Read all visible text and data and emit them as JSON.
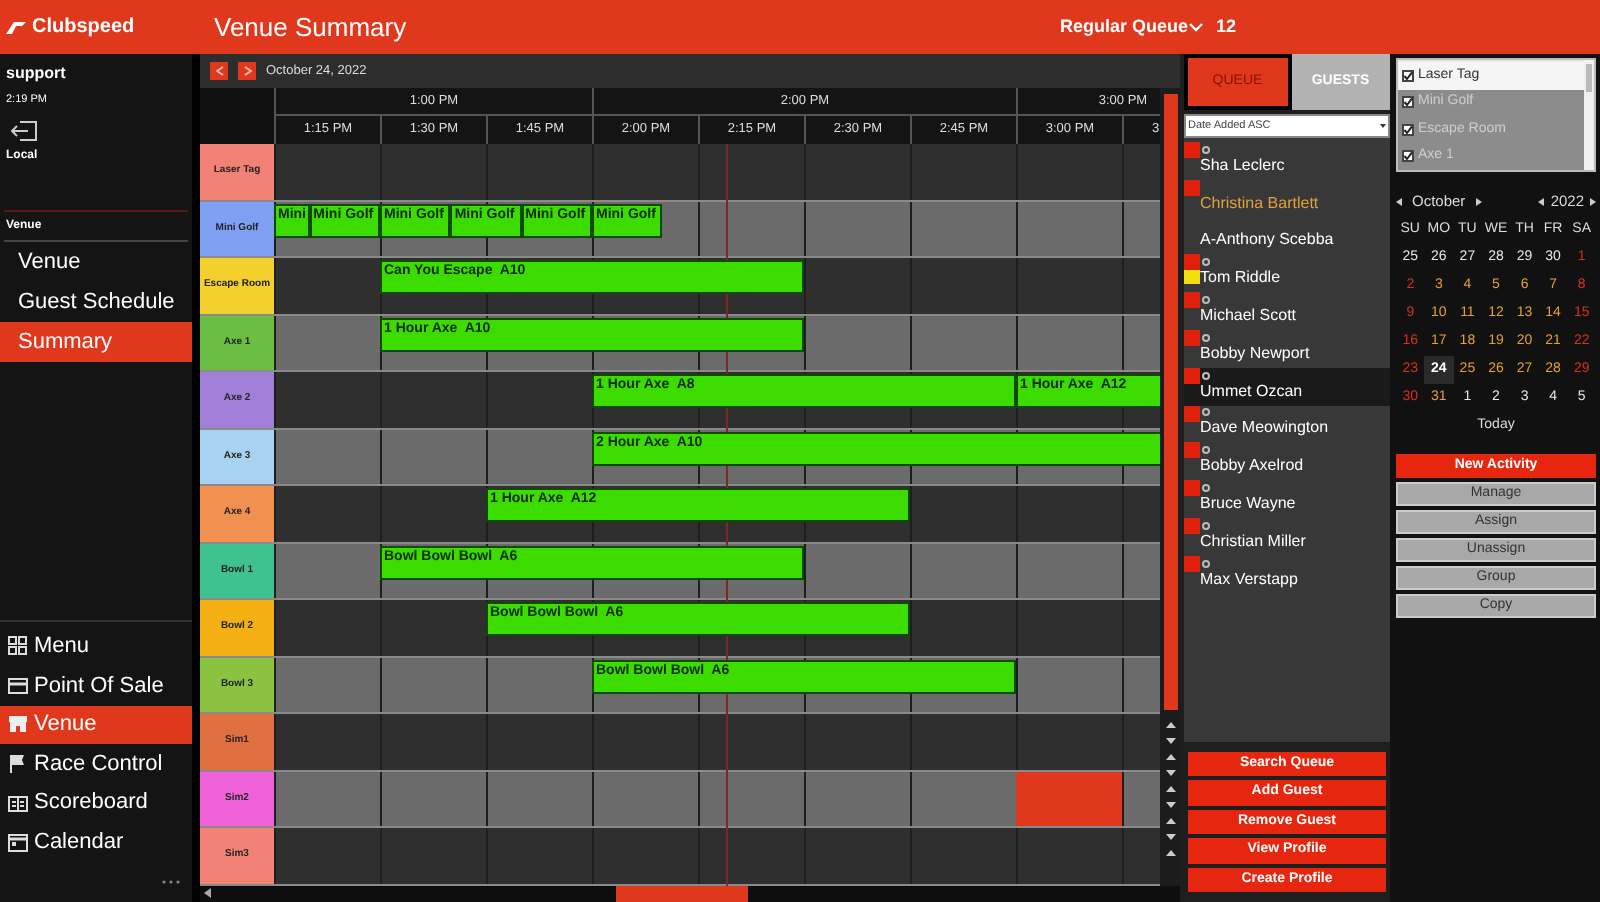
{
  "app": {
    "logo": "Clubspeed",
    "title": "Venue Summary",
    "queue_name": "Regular Queue",
    "queue_count": "12"
  },
  "user": {
    "name": "support",
    "time": "2:19 PM",
    "location": "Local"
  },
  "sidebar": {
    "section": "Venue",
    "items": [
      {
        "label": "Venue",
        "selected": false
      },
      {
        "label": "Guest Schedule",
        "selected": false
      },
      {
        "label": "Summary",
        "selected": true
      }
    ]
  },
  "nav": [
    {
      "label": "Menu",
      "kind": "menu",
      "selected": false
    },
    {
      "label": "Point Of Sale",
      "kind": "pos",
      "selected": false
    },
    {
      "label": "Venue",
      "kind": "venue",
      "selected": true
    },
    {
      "label": "Race Control",
      "kind": "race",
      "selected": false
    },
    {
      "label": "Scoreboard",
      "kind": "scoreboard",
      "selected": false
    },
    {
      "label": "Calendar",
      "kind": "calendar",
      "selected": false
    }
  ],
  "schedule": {
    "date": "October 24, 2022",
    "hours": [
      {
        "label": "1:00 PM"
      },
      {
        "label": "2:00 PM"
      },
      {
        "label": "3:00 PM"
      }
    ],
    "columns": [
      "1:15 PM",
      "1:30 PM",
      "1:45 PM",
      "2:00 PM",
      "2:15 PM",
      "2:30 PM",
      "2:45 PM",
      "3:00 PM",
      "3"
    ],
    "resources": [
      {
        "name": "Laser Tag",
        "color": "#f28276"
      },
      {
        "name": "Mini Golf",
        "color": "#7f9ff2",
        "events": [
          {
            "kind": "booking",
            "label": "Mini"
          },
          {
            "kind": "booking",
            "label": "Mini Golf"
          },
          {
            "kind": "booking",
            "label": "Mini Golf"
          },
          {
            "kind": "booking",
            "label": "Mini Golf"
          },
          {
            "kind": "booking",
            "label": "Mini Golf"
          },
          {
            "kind": "booking",
            "label": "Mini Golf"
          }
        ]
      },
      {
        "name": "Escape Room",
        "color": "#f3d02e",
        "events": [
          {
            "kind": "booking",
            "label": "Can You Escape  A10"
          }
        ]
      },
      {
        "name": "Axe 1",
        "color": "#6cbd43",
        "events": [
          {
            "kind": "booking",
            "label": "1 Hour Axe  A10"
          }
        ]
      },
      {
        "name": "Axe 2",
        "color": "#a17fd9",
        "events": [
          {
            "kind": "booking",
            "label": "1 Hour Axe  A8"
          },
          {
            "kind": "booking",
            "label": "1 Hour Axe  A12"
          }
        ]
      },
      {
        "name": "Axe 3",
        "color": "#a8d3f0",
        "events": [
          {
            "kind": "booking",
            "label": "2 Hour Axe  A10"
          }
        ]
      },
      {
        "name": "Axe 4",
        "color": "#f2914f",
        "events": [
          {
            "kind": "booking",
            "label": "1 Hour Axe  A12"
          }
        ]
      },
      {
        "name": "Bowl 1",
        "color": "#3fc28f",
        "events": [
          {
            "kind": "booking",
            "label": "Bowl Bowl Bowl  A6"
          }
        ]
      },
      {
        "name": "Bowl 2",
        "color": "#f4b012",
        "events": [
          {
            "kind": "booking",
            "label": "Bowl Bowl Bowl  A6"
          }
        ]
      },
      {
        "name": "Bowl 3",
        "color": "#8bc23f",
        "events": [
          {
            "kind": "booking",
            "label": "Bowl Bowl Bowl  A6"
          }
        ]
      },
      {
        "name": "Sim1",
        "color": "#e0703f"
      },
      {
        "name": "Sim2",
        "color": "#f062d9",
        "events": [
          {
            "kind": "blocked"
          }
        ]
      },
      {
        "name": "Sim3",
        "color": "#f28276"
      }
    ]
  },
  "queue": {
    "tabs": [
      {
        "label": "QUEUE",
        "selected": true
      },
      {
        "label": "GUESTS",
        "selected": false
      }
    ],
    "sort": "Date Added ASC",
    "guests": [
      {
        "name": "Sha Leclerc",
        "flag": true,
        "alert": false,
        "linked": true,
        "highlighted": false,
        "selected": false
      },
      {
        "name": "Christina Bartlett",
        "flag": true,
        "alert": false,
        "linked": false,
        "highlighted": true,
        "selected": false
      },
      {
        "name": "A-Anthony Scebba",
        "flag": false,
        "alert": false,
        "linked": false,
        "highlighted": false,
        "selected": false
      },
      {
        "name": "Tom Riddle",
        "flag": true,
        "alert": true,
        "linked": true,
        "highlighted": false,
        "selected": false
      },
      {
        "name": "Michael Scott",
        "flag": true,
        "alert": false,
        "linked": true,
        "highlighted": false,
        "selected": false
      },
      {
        "name": "Bobby Newport",
        "flag": true,
        "alert": false,
        "linked": true,
        "highlighted": false,
        "selected": false
      },
      {
        "name": "Ummet Ozcan",
        "flag": true,
        "alert": false,
        "linked": true,
        "highlighted": false,
        "selected": true
      },
      {
        "name": "Dave Meowington",
        "flag": true,
        "alert": false,
        "linked": true,
        "highlighted": false,
        "selected": false
      },
      {
        "name": "Bobby Axelrod",
        "flag": true,
        "alert": false,
        "linked": true,
        "highlighted": false,
        "selected": false
      },
      {
        "name": "Bruce Wayne",
        "flag": true,
        "alert": false,
        "linked": true,
        "highlighted": false,
        "selected": false
      },
      {
        "name": "Christian Miller",
        "flag": true,
        "alert": false,
        "linked": true,
        "highlighted": false,
        "selected": false
      },
      {
        "name": "Max Verstapp",
        "flag": true,
        "alert": false,
        "linked": true,
        "highlighted": false,
        "selected": false
      }
    ],
    "buttons": [
      "Search Queue",
      "Add Guest",
      "Remove Guest",
      "View Profile",
      "Create Profile"
    ]
  },
  "filters": [
    {
      "label": "Laser Tag",
      "checked": true,
      "selected": false
    },
    {
      "label": "Mini Golf",
      "checked": true,
      "selected": true
    },
    {
      "label": "Escape Room",
      "checked": true,
      "selected": true
    },
    {
      "label": "Axe 1",
      "checked": true,
      "selected": true
    }
  ],
  "calendar": {
    "month": "October",
    "year": "2022",
    "weekdays": [
      "SU",
      "MO",
      "TU",
      "WE",
      "TH",
      "FR",
      "SA"
    ],
    "days": [
      {
        "label": "25",
        "kind": "adjacent",
        "selected": false
      },
      {
        "label": "26",
        "kind": "adjacent",
        "selected": false
      },
      {
        "label": "27",
        "kind": "adjacent",
        "selected": false
      },
      {
        "label": "28",
        "kind": "adjacent",
        "selected": false
      },
      {
        "label": "29",
        "kind": "adjacent",
        "selected": false
      },
      {
        "label": "30",
        "kind": "adjacent",
        "selected": false
      },
      {
        "label": "1",
        "kind": "weekend",
        "selected": false
      },
      {
        "label": "2",
        "kind": "weekend",
        "selected": false
      },
      {
        "label": "3",
        "kind": "weekday",
        "selected": false
      },
      {
        "label": "4",
        "kind": "weekday",
        "selected": false
      },
      {
        "label": "5",
        "kind": "weekday",
        "selected": false
      },
      {
        "label": "6",
        "kind": "weekday",
        "selected": false
      },
      {
        "label": "7",
        "kind": "weekday",
        "selected": false
      },
      {
        "label": "8",
        "kind": "weekend",
        "selected": false
      },
      {
        "label": "9",
        "kind": "weekend",
        "selected": false
      },
      {
        "label": "10",
        "kind": "weekday",
        "selected": false
      },
      {
        "label": "11",
        "kind": "weekday",
        "selected": false
      },
      {
        "label": "12",
        "kind": "weekday",
        "selected": false
      },
      {
        "label": "13",
        "kind": "weekday",
        "selected": false
      },
      {
        "label": "14",
        "kind": "weekday",
        "selected": false
      },
      {
        "label": "15",
        "kind": "weekend",
        "selected": false
      },
      {
        "label": "16",
        "kind": "weekend",
        "selected": false
      },
      {
        "label": "17",
        "kind": "weekday",
        "selected": false
      },
      {
        "label": "18",
        "kind": "weekday",
        "selected": false
      },
      {
        "label": "19",
        "kind": "weekday",
        "selected": false
      },
      {
        "label": "20",
        "kind": "weekday",
        "selected": false
      },
      {
        "label": "21",
        "kind": "weekday",
        "selected": false
      },
      {
        "label": "22",
        "kind": "weekend",
        "selected": false
      },
      {
        "label": "23",
        "kind": "weekend",
        "selected": false
      },
      {
        "label": "24",
        "kind": "weekday",
        "selected": true
      },
      {
        "label": "25",
        "kind": "weekday",
        "selected": false
      },
      {
        "label": "26",
        "kind": "weekday",
        "selected": false
      },
      {
        "label": "27",
        "kind": "weekday",
        "selected": false
      },
      {
        "label": "28",
        "kind": "weekday",
        "selected": false
      },
      {
        "label": "29",
        "kind": "weekend",
        "selected": false
      },
      {
        "label": "30",
        "kind": "weekend",
        "selected": false
      },
      {
        "label": "31",
        "kind": "weekday",
        "selected": false
      },
      {
        "label": "1",
        "kind": "adjacent",
        "selected": false
      },
      {
        "label": "2",
        "kind": "adjacent",
        "selected": false
      },
      {
        "label": "3",
        "kind": "adjacent",
        "selected": false
      },
      {
        "label": "4",
        "kind": "adjacent",
        "selected": false
      },
      {
        "label": "5",
        "kind": "adjacent",
        "selected": false
      }
    ],
    "today": "Today"
  },
  "actions": [
    {
      "label": "New Activity",
      "kind": "primary"
    },
    {
      "label": "Manage",
      "kind": "secondary"
    },
    {
      "label": "Assign",
      "kind": "secondary"
    },
    {
      "label": "Unassign",
      "kind": "secondary"
    },
    {
      "label": "Group",
      "kind": "secondary"
    },
    {
      "label": "Copy",
      "kind": "secondary"
    }
  ]
}
